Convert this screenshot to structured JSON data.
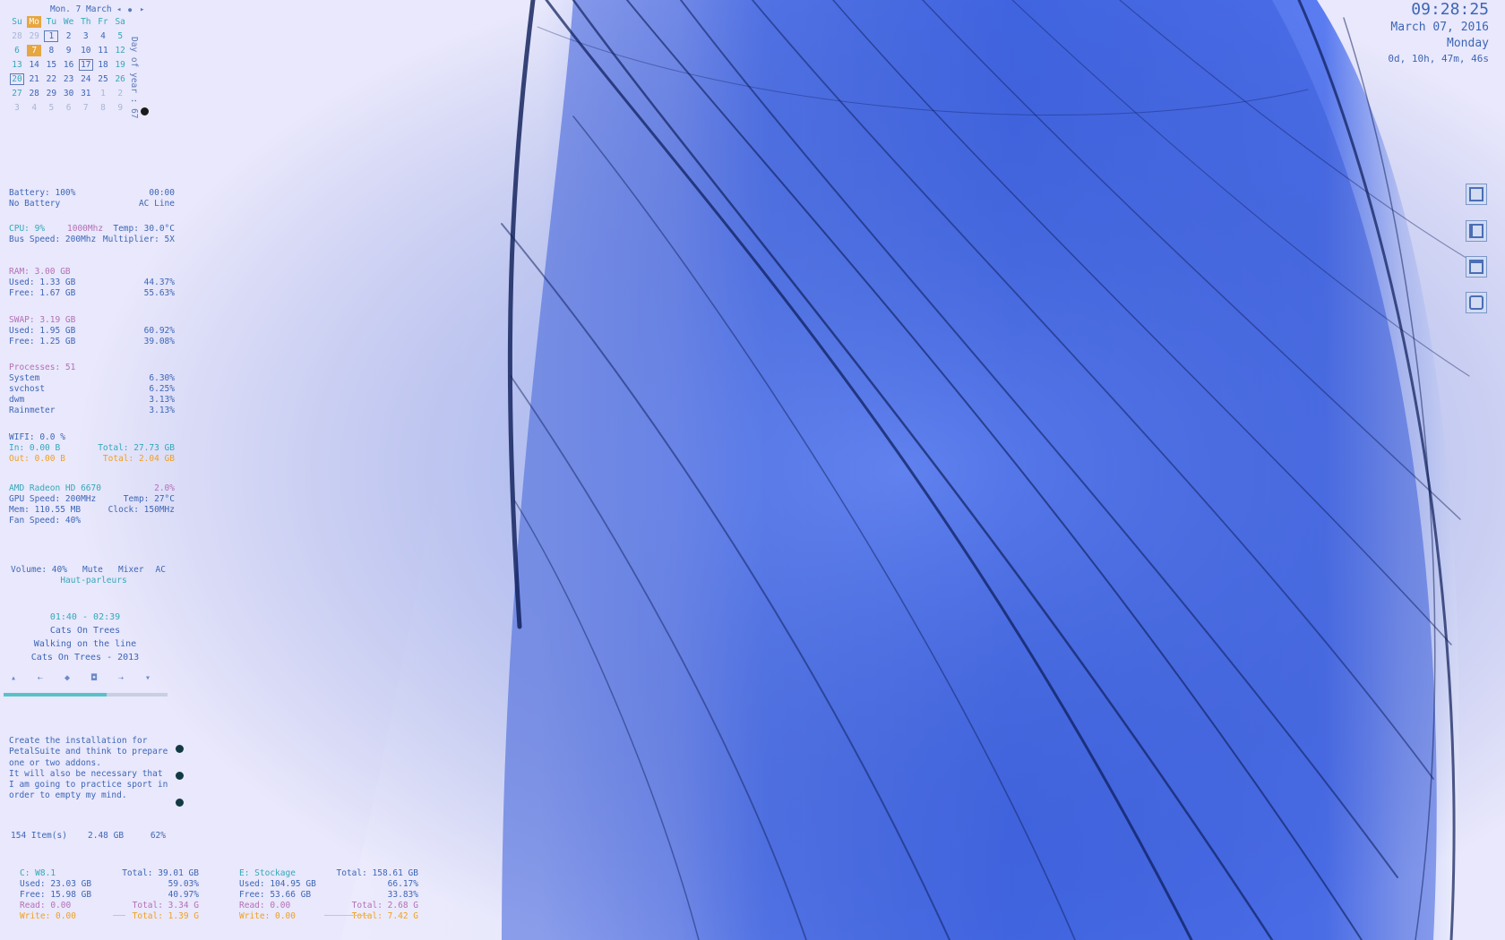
{
  "calendar": {
    "title": "Mon. 7 March",
    "prev_icon": "◂",
    "dot_icon": "●",
    "next_icon": "▸",
    "day_headers": [
      "Su",
      "Mo",
      "Tu",
      "We",
      "Th",
      "Fr",
      "Sa"
    ],
    "weeks": [
      [
        "28",
        "29",
        "1",
        "2",
        "3",
        "4",
        "5"
      ],
      [
        "6",
        "7",
        "8",
        "9",
        "10",
        "11",
        "12"
      ],
      [
        "13",
        "14",
        "15",
        "16",
        "17",
        "18",
        "19"
      ],
      [
        "20",
        "21",
        "22",
        "23",
        "24",
        "25",
        "26"
      ],
      [
        "27",
        "28",
        "29",
        "30",
        "31",
        "1",
        "2"
      ],
      [
        "3",
        "4",
        "5",
        "6",
        "7",
        "8",
        "9"
      ]
    ],
    "day_of_year": "Day of year : 67"
  },
  "clock": {
    "time": "09:28:25",
    "date": "March 07, 2016",
    "day": "Monday",
    "uptime": "0d, 10h, 47m, 46s"
  },
  "battery": {
    "label": "Battery: 100%",
    "time": "00:00",
    "status": "No Battery",
    "source": "AC Line"
  },
  "cpu": {
    "label": "CPU: 9%",
    "freq": "1000Mhz",
    "temp": "Temp: 30.0°C",
    "bus": "Bus Speed: 200Mhz",
    "multiplier": "Multiplier: 5X"
  },
  "ram": {
    "title": "RAM: 3.00 GB",
    "used": "Used: 1.33 GB",
    "used_pct": "44.37%",
    "free": "Free: 1.67 GB",
    "free_pct": "55.63%"
  },
  "swap": {
    "title": "SWAP: 3.19 GB",
    "used": "Used: 1.95 GB",
    "used_pct": "60.92%",
    "free": "Free: 1.25 GB",
    "free_pct": "39.08%"
  },
  "processes": {
    "title": "Processes: 51",
    "items": [
      {
        "name": "System",
        "pct": "6.30%"
      },
      {
        "name": "svchost",
        "pct": "6.25%"
      },
      {
        "name": "dwm",
        "pct": "3.13%"
      },
      {
        "name": "Rainmeter",
        "pct": "3.13%"
      }
    ]
  },
  "network": {
    "wifi": "WIFI: 0.0 %",
    "in": "In: 0.00 B",
    "in_total": "Total: 27.73 GB",
    "out": "Out: 0.00 B",
    "out_total": "Total: 2.04 GB"
  },
  "gpu": {
    "name": "AMD Radeon HD 6670",
    "load": "2.0%",
    "speed": "GPU Speed: 200MHz",
    "temp": "Temp: 27°C",
    "mem": "Mem: 110.55 MB",
    "clock": "Clock: 150MHz",
    "fan": "Fan Speed: 40%"
  },
  "volume": {
    "level": "Volume: 40%",
    "mute": "Mute",
    "mixer": "Mixer",
    "ac": "AC",
    "device": "Haut-parleurs"
  },
  "media": {
    "elapsed": "01:40",
    "separator": "-",
    "total": "02:39",
    "artist": "Cats On Trees",
    "track": "Walking on the line",
    "album": "Cats On Trees - 2013",
    "controls": [
      {
        "name": "shuffle-icon",
        "glyph": "▴"
      },
      {
        "name": "previous-icon",
        "glyph": "⇠"
      },
      {
        "name": "play-icon",
        "glyph": "◆"
      },
      {
        "name": "stop-icon",
        "glyph": "◘"
      },
      {
        "name": "next-icon",
        "glyph": "⇢"
      },
      {
        "name": "repeat-icon",
        "glyph": "▾"
      }
    ],
    "progress": 0.63
  },
  "notes": {
    "items": [
      "Create the installation for PetalSuite and think to prepare one or two addons.",
      "It will also be necessary that I am going to practice sport in order to empty my mind."
    ]
  },
  "recycle_bin": {
    "items": "154 Item(s)",
    "size": "2.48 GB",
    "pct": "62%"
  },
  "drives": [
    {
      "name": "C: W8.1",
      "total": "Total: 39.01 GB",
      "used": "Used: 23.03 GB",
      "used_pct": "59.03%",
      "free": "Free: 15.98 GB",
      "free_pct": "40.97%",
      "read": "Read: 0.00",
      "read_total": "Total: 3.34 G",
      "write": "Write: 0.00",
      "write_total": "Total: 1.39 G"
    },
    {
      "name": "E: Stockage",
      "total": "Total: 158.61 GB",
      "used": "Used: 104.95 GB",
      "used_pct": "66.17%",
      "free": "Free: 53.66 GB",
      "free_pct": "33.83%",
      "read": "Read: 0.00",
      "read_total": "Total: 2.68 G",
      "write": "Write: 0.00",
      "write_total": "Total: 7.42 G"
    }
  ],
  "colors": {
    "accent": "#3d66b5",
    "teal": "#34a8b8",
    "pink": "#b470b5",
    "orange": "#f0a020",
    "today": "#e6a640"
  }
}
